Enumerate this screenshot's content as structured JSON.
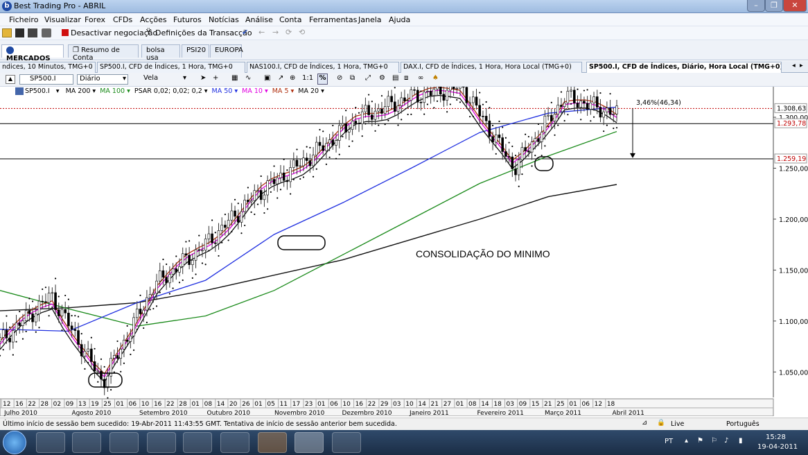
{
  "window": {
    "title": "Best Trading Pro - ABRIL",
    "minimize": "–",
    "maximize": "❐",
    "close": "✕"
  },
  "menu": [
    "Ficheiro",
    "Visualizar",
    "Forex",
    "CFDs",
    "Acções",
    "Futuros",
    "Notícias",
    "Análise",
    "Conta",
    "Ferramentas",
    "Janela",
    "Ajuda"
  ],
  "toolbar": {
    "deactivate": "Desactivar negociação",
    "settings": "Definições da Transacção"
  },
  "main_tabs": [
    "MERCADOS",
    "Resumo de Conta",
    "bolsa usa",
    "PSI20",
    "EUROPA"
  ],
  "chart_tabs": [
    "ndices, 10 Minutos, TMG+0",
    "SP500.I, CFD de Índices, 1 Hora, TMG+0",
    "NAS100.I, CFD de Índices, 1 Hora, TMG+0",
    "DAX.I, CFD de Índices, 1 Hora, Hora Local (TMG+0)",
    "SP500.I, CFD de Índices, Diário, Hora Local (TMG+0)"
  ],
  "chart_toolbar": {
    "symbol": "SP500.I",
    "period": "Diário",
    "type": "Vela"
  },
  "legend": {
    "symbol": "SP500.I",
    "items": [
      {
        "label": "MA 200",
        "color": "#000000"
      },
      {
        "label": "MA 100",
        "color": "#1a8a1a"
      },
      {
        "label": "PSAR 0,02; 0,02; 0,2",
        "color": "#000000"
      },
      {
        "label": "MA 50",
        "color": "#1f2fe0"
      },
      {
        "label": "MA 10",
        "color": "#e000e0"
      },
      {
        "label": "MA 5",
        "color": "#b03010"
      },
      {
        "label": "MA 20",
        "color": "#000000"
      }
    ]
  },
  "chart_data": {
    "type": "line",
    "ylim": [
      1025,
      1330
    ],
    "y_ticks": [
      1050,
      1100,
      1150,
      1200,
      1250,
      1300
    ],
    "y_tick_labels": [
      "1.050,00",
      "1.100,00",
      "1.150,00",
      "1.200,00",
      "1.250,00",
      "1.300,00"
    ],
    "price_tags": [
      {
        "label": "1.308,63",
        "value": 1308.63,
        "color": "#000000"
      },
      {
        "label": "1.293,78",
        "value": 1293.78,
        "color": "#c00000"
      },
      {
        "label": "1.259,19",
        "value": 1259.19,
        "color": "#c00000"
      }
    ],
    "day_labels": [
      "12",
      "16",
      "22",
      "28",
      "02",
      "09",
      "13",
      "19",
      "25",
      "01",
      "06",
      "10",
      "16",
      "22",
      "28",
      "01",
      "08",
      "14",
      "20",
      "26",
      "01",
      "05",
      "11",
      "17",
      "23",
      "01",
      "06",
      "10",
      "16",
      "22",
      "29",
      "03",
      "10",
      "14",
      "21",
      "27",
      "01",
      "08",
      "14",
      "18",
      "03",
      "09",
      "15",
      "21",
      "25",
      "01",
      "06",
      "12",
      "18"
    ],
    "month_labels": [
      "Julho 2010",
      "Agosto 2010",
      "Setembro 2010",
      "Outubro 2010",
      "Novembro 2010",
      "Dezembro 2010",
      "Janeiro 2011",
      "Fevereiro 2011",
      "Março 2011",
      "Abril 2011"
    ],
    "annotation": "CONSOLIDAÇÃO DO MINIMO",
    "measure_label": "3,46%(46,34)",
    "ma200": [
      1110,
      1113,
      1118,
      1130,
      1145,
      1160,
      1180,
      1200,
      1222,
      1234
    ],
    "ma100": [
      1130,
      1112,
      1095,
      1105,
      1130,
      1165,
      1200,
      1235,
      1262,
      1286
    ],
    "ma50": [
      1092,
      1090,
      1118,
      1140,
      1185,
      1216,
      1250,
      1285,
      1304,
      1310
    ],
    "price": [
      1080,
      1125,
      1040,
      1135,
      1175,
      1225,
      1260,
      1300,
      1320,
      1330,
      1250,
      1320,
      1303
    ]
  },
  "status": {
    "message": "Último início de sessão bem sucedido: 19-Abr-2011 11:43:55 GMT. Tentativa de início de sessão anterior bem sucedida.",
    "live": "Live",
    "language": "Português"
  },
  "taskbar": {
    "lang": "PT",
    "time": "15:28",
    "date": "19-04-2011"
  }
}
